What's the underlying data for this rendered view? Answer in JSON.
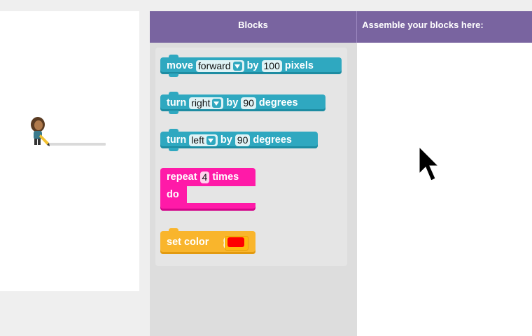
{
  "header": {
    "blocks_title": "Blocks",
    "workspace_title": "Assemble your blocks here:"
  },
  "blocks": {
    "move": {
      "word1": "move",
      "direction": "forward",
      "word2": "by",
      "amount": "100",
      "unit": "pixels"
    },
    "turn_right": {
      "word1": "turn",
      "direction": "right",
      "word2": "by",
      "amount": "90",
      "unit": "degrees"
    },
    "turn_left": {
      "word1": "turn",
      "direction": "left",
      "word2": "by",
      "amount": "90",
      "unit": "degrees"
    },
    "repeat": {
      "word1": "repeat",
      "count": "4",
      "word2": "times",
      "do_label": "do"
    },
    "set_color": {
      "label": "set color",
      "color": "#ff0000"
    }
  },
  "colors": {
    "header": "#7964a0",
    "motion_block": "#2fa8c0",
    "loop_block": "#ff1aa8",
    "color_block": "#f9b52c"
  },
  "icons": {
    "artist": "artist-sprite",
    "cursor": "arrow-cursor"
  }
}
